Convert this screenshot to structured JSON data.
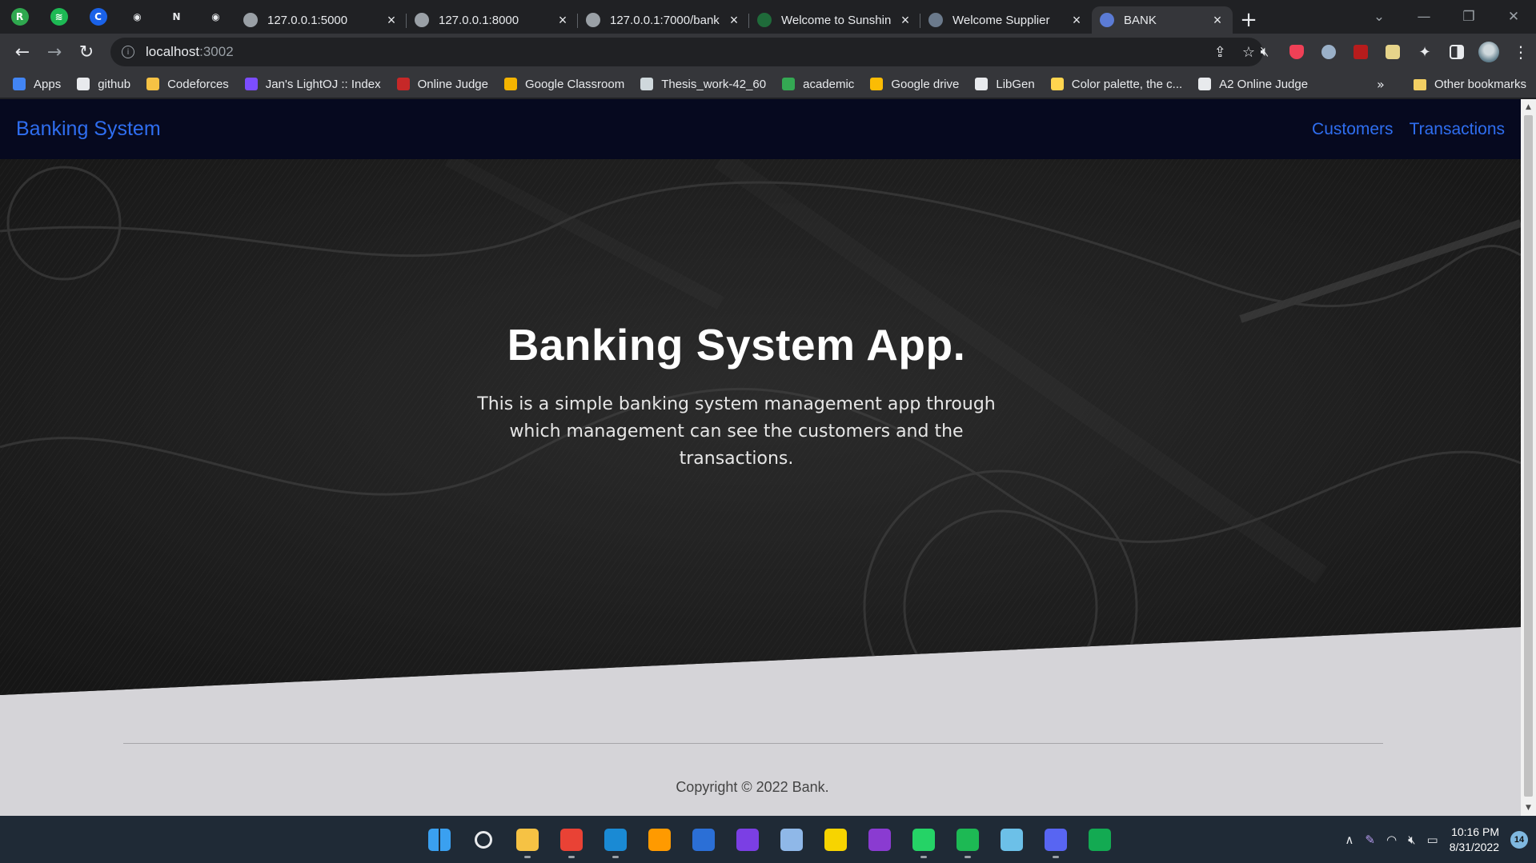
{
  "browser": {
    "pinned_tabs": [
      {
        "icon": "rpc-icon",
        "color": "#2fa84f",
        "glyph": "R"
      },
      {
        "icon": "spotify-icon",
        "color": "#1db954",
        "glyph": "≋"
      },
      {
        "icon": "c-icon",
        "color": "#1a62e8",
        "glyph": "C"
      },
      {
        "icon": "github-icon",
        "color": "#e8eaed",
        "glyph": "◉"
      },
      {
        "icon": "notion-icon",
        "color": "#e8eaed",
        "glyph": "N"
      },
      {
        "icon": "github-icon",
        "color": "#e8eaed",
        "glyph": "◉"
      }
    ],
    "tabs": [
      {
        "title": "127.0.0.1:5000",
        "favicon_color": "#9aa0a6",
        "active": false
      },
      {
        "title": "127.0.0.1:8000",
        "favicon_color": "#9aa0a6",
        "active": false
      },
      {
        "title": "127.0.0.1:7000/bank",
        "favicon_color": "#9aa0a6",
        "active": false
      },
      {
        "title": "Welcome to Sunshin",
        "favicon_color": "#1f6b3a",
        "active": false
      },
      {
        "title": "Welcome Supplier",
        "favicon_color": "#6b7a8c",
        "active": false
      },
      {
        "title": "BANK",
        "favicon_color": "#5b7bd5",
        "active": true
      }
    ],
    "address": {
      "host": "localhost",
      "port": ":3002"
    },
    "bookmarks": [
      {
        "label": "Apps",
        "color": "#4285f4"
      },
      {
        "label": "github",
        "color": "#e8eaed"
      },
      {
        "label": "Codeforces",
        "color": "#f6c244"
      },
      {
        "label": "Jan's LightOJ :: Index",
        "color": "#7c4dff"
      },
      {
        "label": "Online Judge",
        "color": "#c62828"
      },
      {
        "label": "Google Classroom",
        "color": "#f4b400"
      },
      {
        "label": "Thesis_work-42_60",
        "color": "#cfd8dc"
      },
      {
        "label": "academic",
        "color": "#34a853"
      },
      {
        "label": "Google drive",
        "color": "#fbbc04"
      },
      {
        "label": "LibGen",
        "color": "#e8eaed"
      },
      {
        "label": "Color palette, the c...",
        "color": "#ffd54f"
      },
      {
        "label": "A2 Online Judge",
        "color": "#e8eaed"
      }
    ],
    "other_bookmarks": "Other bookmarks",
    "more_glyph": "»"
  },
  "site": {
    "brand": "Banking System",
    "nav_links": [
      "Customers",
      "Transactions"
    ],
    "hero_title": "Banking System App.",
    "hero_text": "This is a simple banking system management app through which management can see the customers and the transactions.",
    "footer_copyright": "Copyright © 2022 Bank."
  },
  "taskbar": {
    "apps": [
      {
        "name": "windows-start-icon",
        "color": "#3aa0f0",
        "running": false
      },
      {
        "name": "search-icon",
        "color": "#e8eaed",
        "running": false
      },
      {
        "name": "file-explorer-icon",
        "color": "#f6c244",
        "running": true
      },
      {
        "name": "chrome-icon",
        "color": "#e94235",
        "running": true
      },
      {
        "name": "vscode-icon",
        "color": "#1a8ad4",
        "running": true
      },
      {
        "name": "illustrator-icon",
        "color": "#ff9a00",
        "running": false
      },
      {
        "name": "word-icon",
        "color": "#2b6fd6",
        "running": false
      },
      {
        "name": "intellij-icon",
        "color": "#7b3fe4",
        "running": false
      },
      {
        "name": "photos-icon",
        "color": "#8fb8e8",
        "running": false
      },
      {
        "name": "sticky-notes-icon",
        "color": "#f7d400",
        "running": false
      },
      {
        "name": "onenote-icon",
        "color": "#8a3bd1",
        "running": false
      },
      {
        "name": "whatsapp-icon",
        "color": "#25d366",
        "running": true
      },
      {
        "name": "spotify-icon",
        "color": "#1db954",
        "running": true
      },
      {
        "name": "notepad-icon",
        "color": "#6cc0e8",
        "running": false
      },
      {
        "name": "discord-icon",
        "color": "#5865f2",
        "running": true
      },
      {
        "name": "mongodb-compass-icon",
        "color": "#13aa52",
        "running": false
      }
    ],
    "time": "10:16 PM",
    "date": "8/31/2022",
    "notification_count": "14"
  }
}
